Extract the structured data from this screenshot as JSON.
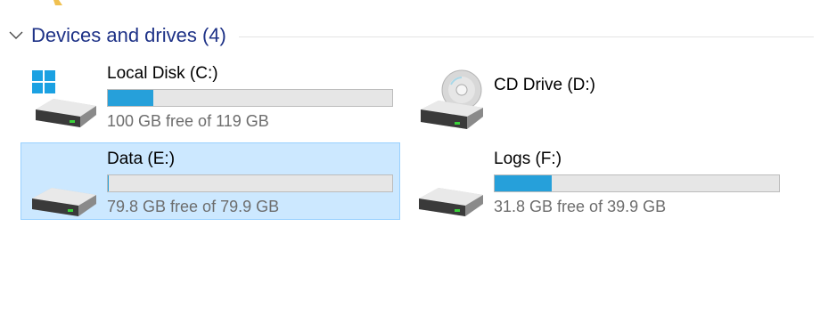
{
  "group": {
    "title": "Devices and drives (4)"
  },
  "colors": {
    "accent": "#26a0da",
    "selection_bg": "#cce8ff",
    "selection_border": "#99d1ff",
    "title": "#1e3287"
  },
  "drives": [
    {
      "name": "Local Disk (C:)",
      "free_text": "100 GB free of 119 GB",
      "used_fraction": 0.16,
      "icon": "windows-drive-icon",
      "selected": false
    },
    {
      "name": "CD Drive (D:)",
      "free_text": "",
      "used_fraction": null,
      "icon": "cd-drive-icon",
      "selected": false
    },
    {
      "name": "Data (E:)",
      "free_text": "79.8 GB free of 79.9 GB",
      "used_fraction": 0.001,
      "icon": "hard-drive-icon",
      "selected": true
    },
    {
      "name": "Logs (F:)",
      "free_text": "31.8 GB free of 39.9 GB",
      "used_fraction": 0.2,
      "icon": "hard-drive-icon",
      "selected": false
    }
  ]
}
